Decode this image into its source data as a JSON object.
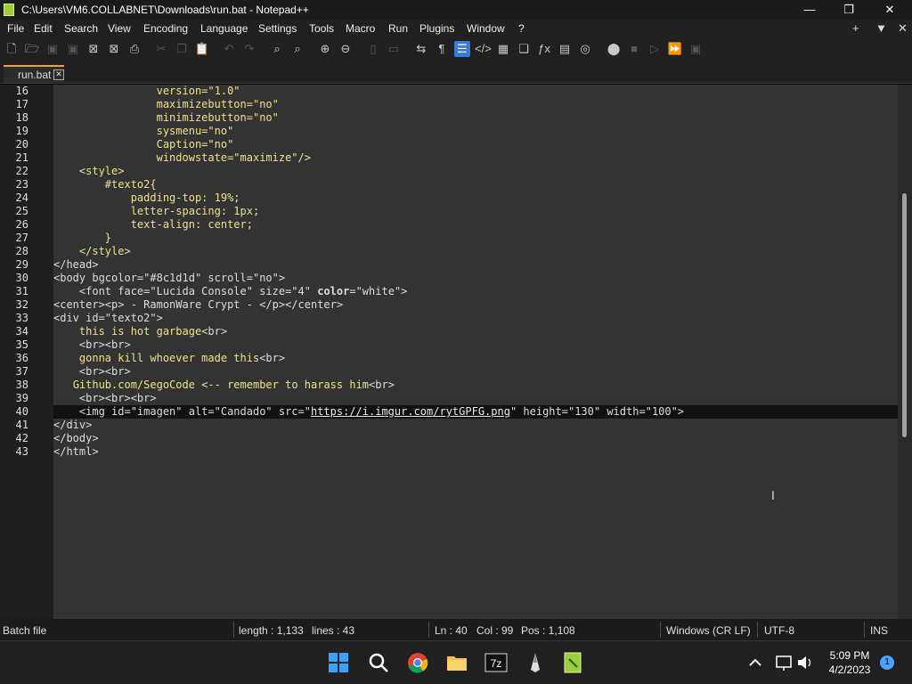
{
  "window": {
    "title": "C:\\Users\\VM6.COLLABNET\\Downloads\\run.bat - Notepad++",
    "minimize": "—",
    "maximize": "❐",
    "close": "✕"
  },
  "menu": {
    "items": [
      "File",
      "Edit",
      "Search",
      "View",
      "Encoding",
      "Language",
      "Settings",
      "Tools",
      "Macro",
      "Run",
      "Plugins",
      "Window",
      "?"
    ],
    "right": [
      "+",
      "▼",
      "✕"
    ]
  },
  "tab": {
    "label": "run.bat",
    "close": "✕"
  },
  "editor": {
    "current_line": 40,
    "lines": [
      {
        "n": "16",
        "html": "                <span class=\"hl\">version=\"1.0\"</span>"
      },
      {
        "n": "17",
        "html": "                <span class=\"hl\">maximizebutton=\"no\"</span>"
      },
      {
        "n": "18",
        "html": "                <span class=\"hl\">minimizebutton=\"no\"</span>"
      },
      {
        "n": "19",
        "html": "                <span class=\"hl\">sysmenu=\"no\"</span>"
      },
      {
        "n": "20",
        "html": "                <span class=\"hl\">Caption=\"no\"</span>"
      },
      {
        "n": "21",
        "html": "                <span class=\"hl\">windowstate=\"maximize\"/></span>"
      },
      {
        "n": "22",
        "html": "    <span class=\"hl\">&lt;style&gt;</span>"
      },
      {
        "n": "23",
        "html": "        <span class=\"hl\">#texto2{</span>"
      },
      {
        "n": "24",
        "html": "            <span class=\"hl\">padding-top: 19%;</span>"
      },
      {
        "n": "25",
        "html": "            <span class=\"hl\">letter-spacing: 1px;</span>"
      },
      {
        "n": "26",
        "html": "            <span class=\"hl\">text-align: center;</span>"
      },
      {
        "n": "27",
        "html": "        <span class=\"hl\">}</span>"
      },
      {
        "n": "28",
        "html": "    <span class=\"hl\">&lt;/style&gt;</span>"
      },
      {
        "n": "29",
        "html": "&lt;/head&gt;"
      },
      {
        "n": "30",
        "html": "&lt;body bgcolor=\"#8c1d1d\" scroll=\"no\"&gt;"
      },
      {
        "n": "31",
        "html": "    &lt;font face=\"Lucida Console\" size=\"4\" <b>color</b>=\"white\"&gt;"
      },
      {
        "n": "32",
        "html": "&lt;center&gt;&lt;p&gt; - RamonWare Crypt - &lt;/p&gt;&lt;/center&gt;"
      },
      {
        "n": "33",
        "html": "&lt;div id=\"texto2\"&gt;"
      },
      {
        "n": "34",
        "html": "    <span class=\"hl\">this is hot garbage</span>&lt;br&gt;"
      },
      {
        "n": "35",
        "html": "    &lt;br&gt;&lt;br&gt;"
      },
      {
        "n": "36",
        "html": "    <span class=\"hl\">gonna kill whoever made this</span>&lt;br&gt;"
      },
      {
        "n": "37",
        "html": "    &lt;br&gt;&lt;br&gt;"
      },
      {
        "n": "38",
        "html": "   <span class=\"hl\">Github.com/SegoCode &lt;-- remember to harass him</span>&lt;br&gt;"
      },
      {
        "n": "39",
        "html": "    &lt;br&gt;&lt;br&gt;&lt;br&gt;"
      },
      {
        "n": "40",
        "html": "    &lt;img id=\"imagen\" alt=\"Candado\" src=\"<span class=\"url\">https://i.imgur.com/rytGPFG.png</span>\" height=\"130\" width=\"100\"&gt;"
      },
      {
        "n": "41",
        "html": "&lt;/div&gt;"
      },
      {
        "n": "42",
        "html": "&lt;/body&gt;"
      },
      {
        "n": "43",
        "html": "&lt;/html&gt;"
      }
    ]
  },
  "status": {
    "filetype": "Batch file",
    "length": "length : 1,133",
    "lines": "lines : 43",
    "ln": "Ln : 40",
    "col": "Col : 99",
    "pos": "Pos : 1,108",
    "eol": "Windows (CR LF)",
    "encoding": "UTF-8",
    "mode": "INS"
  },
  "taskbar": {
    "time": "5:09 PM",
    "date": "4/2/2023",
    "notifications": "1"
  }
}
